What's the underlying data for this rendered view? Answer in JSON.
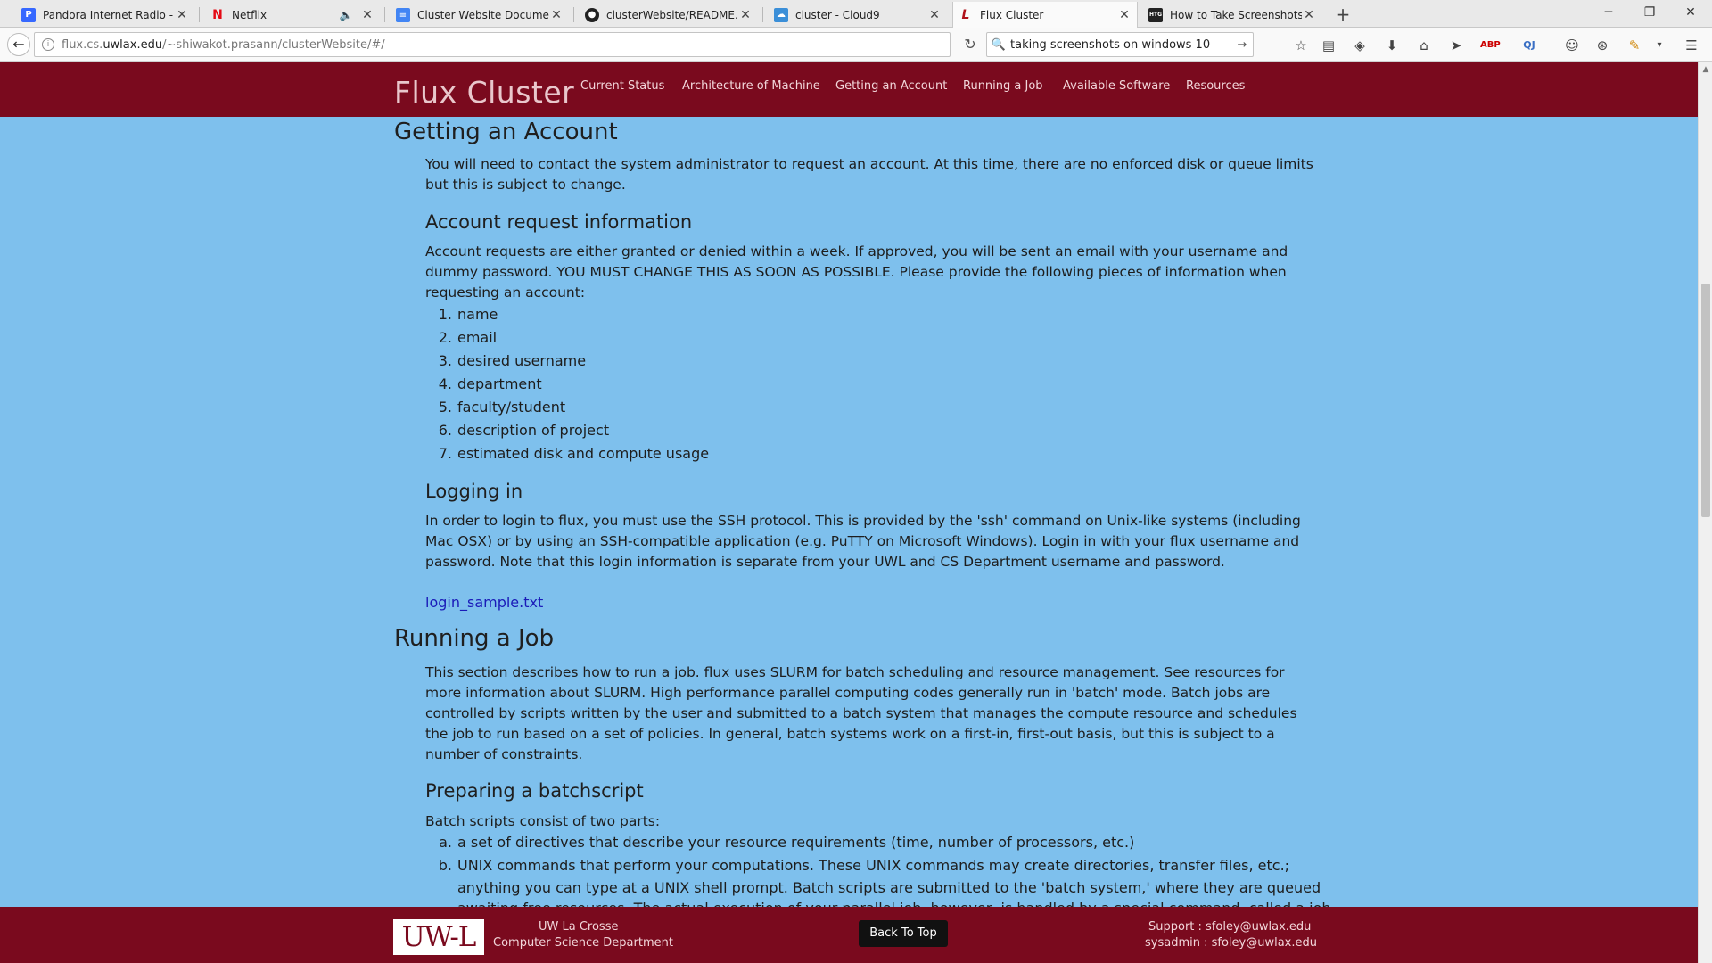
{
  "browser": {
    "tabs": [
      {
        "title": "Pandora Internet Radio - L...",
        "icon": "P",
        "icon_color": "#3668ff"
      },
      {
        "title": "Netflix",
        "icon": "N",
        "icon_color": "#e50914"
      },
      {
        "title": "Cluster Website Documen...",
        "icon": "≡",
        "icon_color": "#4285f4"
      },
      {
        "title": "clusterWebsite/README....",
        "icon": "●",
        "icon_color": "#222222"
      },
      {
        "title": "cluster - Cloud9",
        "icon": "☁",
        "icon_color": "#3b8fd8"
      },
      {
        "title": "Flux Cluster",
        "icon": "L",
        "icon_color": "#b0121b"
      },
      {
        "title": "How to Take Screenshots i...",
        "icon": "HTG",
        "icon_color": "#222222"
      }
    ],
    "active_tab": 5,
    "url": {
      "prefix": "flux.cs.",
      "domain": "uwlax.edu",
      "path": "/~shiwakot.prasann/clusterWebsite/#/"
    },
    "search_value": "taking screenshots on windows 10"
  },
  "site": {
    "brand": "Flux Cluster",
    "nav": [
      "Current Status",
      "Architecture of Machine",
      "Getting an Account",
      "Running a Job",
      "Available Software",
      "Resources"
    ]
  },
  "content": {
    "getting_account": {
      "heading": "Getting an Account",
      "intro": "You will need to contact the system administrator to request an account. At this time, there are no enforced disk or queue limits but this is subject to change."
    },
    "account_request": {
      "heading": "Account request information",
      "text": "Account requests are either granted or denied within a week. If approved, you will be sent an email with your username and dummy password. YOU MUST CHANGE THIS AS SOON AS POSSIBLE. Please provide the following pieces of information when requesting an account:",
      "items": [
        "name",
        "email",
        "desired username",
        "department",
        "faculty/student",
        "description of project",
        "estimated disk and compute usage"
      ]
    },
    "logging_in": {
      "heading": "Logging in",
      "text": "In order to login to flux, you must use the SSH protocol. This is provided by the 'ssh' command on Unix-like systems (including Mac OSX) or by using an SSH-compatible application (e.g. PuTTY on Microsoft Windows). Login in with your flux username and password. Note that this login information is separate from your UWL and CS Department username and password.",
      "link": "login_sample.txt"
    },
    "running_job": {
      "heading": "Running a Job",
      "text": "This section describes how to run a job. flux uses SLURM for batch scheduling and resource management. See resources for more information about SLURM. High performance parallel computing codes generally run in 'batch' mode. Batch jobs are controlled by scripts written by the user and submitted to a batch system that manages the compute resource and schedules the job to run based on a set of policies. In general, batch systems work on a first-in, first-out basis, but this is subject to a number of constraints."
    },
    "batchscript": {
      "heading": "Preparing a batchscript",
      "text": "Batch scripts consist of two parts:",
      "items": [
        {
          "marker": "a.",
          "text": "a set of directives that describe your resource requirements (time, number of processors, etc.)"
        },
        {
          "marker": "b.",
          "text": "UNIX commands that perform your computations. These UNIX commands may create directories, transfer files, etc.;"
        },
        {
          "marker": "",
          "text": "anything you can type at a UNIX shell prompt. Batch scripts are submitted to the 'batch system,' where they are queued"
        },
        {
          "marker": "",
          "text": "awaiting free resources. The actual execution of your parallel job, however, is handled by a special command, called a job"
        }
      ]
    }
  },
  "footer": {
    "logo_text": "UW-L",
    "org_line1": "UW La Crosse",
    "org_line2": "Computer Science Department",
    "back_to_top": "Back To Top",
    "support": "Support : sfoley@uwlax.edu",
    "sysadmin": "sysadmin : sfoley@uwlax.edu"
  }
}
